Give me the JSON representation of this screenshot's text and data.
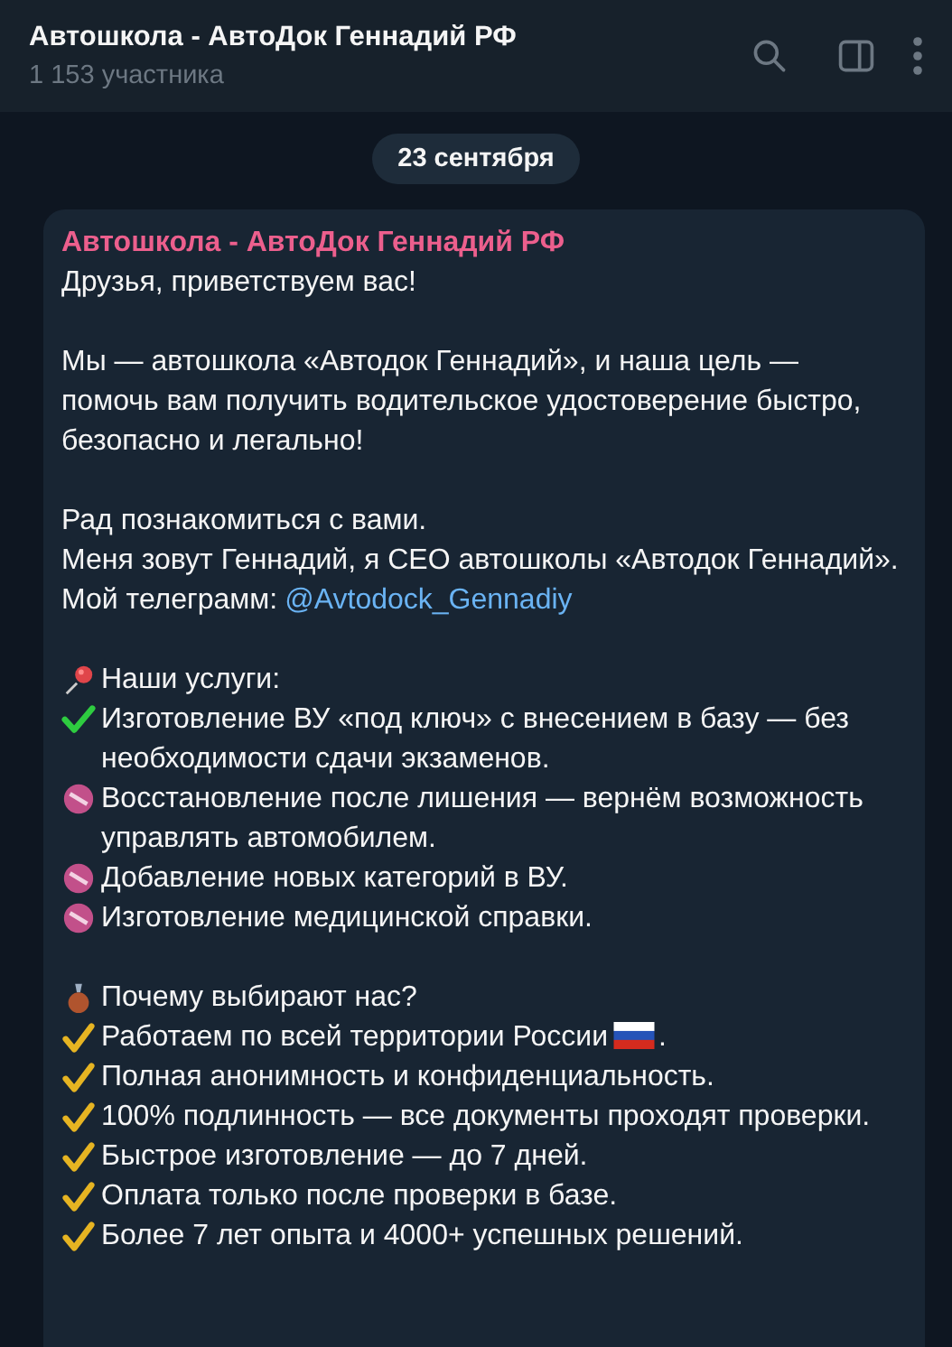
{
  "header": {
    "title": "Автошкола - АвтоДок Геннадий РФ",
    "subtitle": "1 153 участника"
  },
  "date": "23 сентября",
  "message": {
    "sender": "Автошкола - АвтоДок Геннадий РФ",
    "paragraphs": [
      {
        "lines": [
          {
            "kind": "plain",
            "text": "Друзья, приветствуем вас!"
          }
        ]
      },
      {
        "lines": [
          {
            "kind": "plain",
            "text": "Мы — автошкола «Автодок Геннадий», и наша цель — помочь вам получить водительское удостоверение быстро, безопасно и легально!"
          }
        ]
      },
      {
        "lines": [
          {
            "kind": "plain",
            "text": "Рад познакомиться с вами."
          },
          {
            "kind": "plain",
            "text": "Меня зовут Геннадий, я CEO автошколы «Автодок Геннадий»."
          },
          {
            "kind": "plain",
            "text": "Мой телеграмм:",
            "link": "@Avtodock_Gennadiy"
          }
        ]
      },
      {
        "lines": [
          {
            "kind": "pin",
            "text": "Наши услуги:"
          },
          {
            "kind": "check",
            "text": "Изготовление ВУ «под ключ» с внесением в базу — без необходимости сдачи экзаменов."
          },
          {
            "kind": "badge",
            "text": "Восстановление после лишения — вернём возможность управлять автомобилем."
          },
          {
            "kind": "badge",
            "text": "Добавление новых категорий в ВУ."
          },
          {
            "kind": "badge",
            "text": "Изготовление медицинской справки."
          }
        ]
      },
      {
        "lines": [
          {
            "kind": "bag",
            "text": "Почему выбирают нас?"
          },
          {
            "kind": "tick",
            "text": "Работаем по всей территории России",
            "tail": "."
          },
          {
            "kind": "tick",
            "text": "Полная анонимность и конфиденциальность."
          },
          {
            "kind": "tick",
            "text": "100% подлинность — все документы проходят проверки."
          },
          {
            "kind": "tick",
            "text": "Быстрое изготовление — до 7 дней."
          },
          {
            "kind": "tick",
            "text": "Оплата только после проверки в базе."
          },
          {
            "kind": "tick",
            "text": "Более 7 лет опыта и 4000+ успешных решений."
          }
        ]
      }
    ]
  }
}
